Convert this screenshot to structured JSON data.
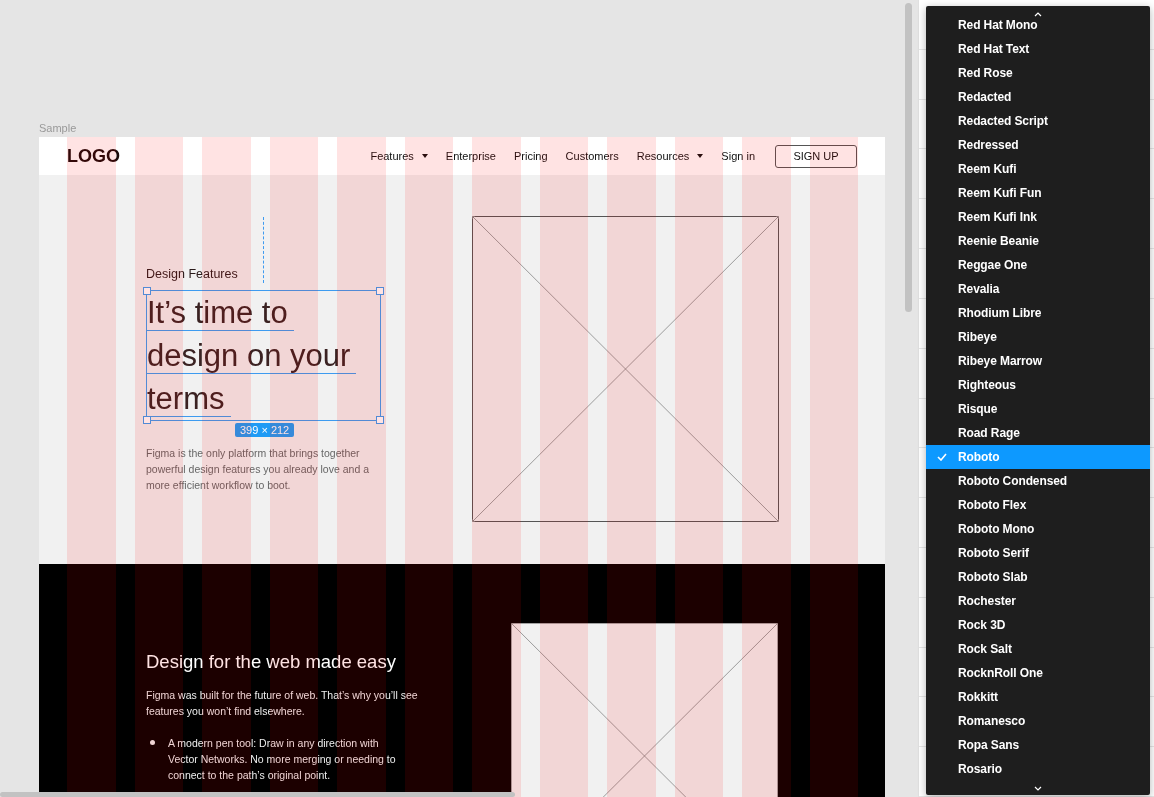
{
  "canvas": {
    "frame_label": "Sample"
  },
  "nav": {
    "logo": "LOGO",
    "links": [
      {
        "label": "Features",
        "dropdown": true
      },
      {
        "label": "Enterprise",
        "dropdown": false
      },
      {
        "label": "Pricing",
        "dropdown": false
      },
      {
        "label": "Customers",
        "dropdown": false
      },
      {
        "label": "Resources",
        "dropdown": true
      },
      {
        "label": "Sign in",
        "dropdown": false
      }
    ],
    "signup_button": "SIGN UP"
  },
  "hero": {
    "eyebrow": "Design Features",
    "heading_lines": [
      "It’s time to",
      "design on your",
      "terms"
    ],
    "selection_size": "399 × 212",
    "body": "Figma is the only platform that brings together powerful design features you already love and a more efficient workflow to boot."
  },
  "dark_section": {
    "heading": "Design for the web made easy",
    "body": "Figma was built for the future of web. That’s why you’ll see features you won’t find elsewhere.",
    "bullets": [
      "A modern pen tool: Draw in any direction with Vector Networks. No more merging or needing to connect to the path’s original point."
    ]
  },
  "font_menu": {
    "items": [
      {
        "label": "Red Hat Mono",
        "selected": false
      },
      {
        "label": "Red Hat Text",
        "selected": false
      },
      {
        "label": "Red Rose",
        "selected": false
      },
      {
        "label": "Redacted",
        "selected": false
      },
      {
        "label": "Redacted Script",
        "selected": false
      },
      {
        "label": "Redressed",
        "selected": false
      },
      {
        "label": "Reem Kufi",
        "selected": false
      },
      {
        "label": "Reem Kufi Fun",
        "selected": false
      },
      {
        "label": "Reem Kufi Ink",
        "selected": false
      },
      {
        "label": "Reenie Beanie",
        "selected": false
      },
      {
        "label": "Reggae One",
        "selected": false
      },
      {
        "label": "Revalia",
        "selected": false
      },
      {
        "label": "Rhodium Libre",
        "selected": false
      },
      {
        "label": "Ribeye",
        "selected": false
      },
      {
        "label": "Ribeye Marrow",
        "selected": false
      },
      {
        "label": "Righteous",
        "selected": false
      },
      {
        "label": "Risque",
        "selected": false
      },
      {
        "label": "Road Rage",
        "selected": false
      },
      {
        "label": "Roboto",
        "selected": true
      },
      {
        "label": "Roboto Condensed",
        "selected": false
      },
      {
        "label": "Roboto Flex",
        "selected": false
      },
      {
        "label": "Roboto Mono",
        "selected": false
      },
      {
        "label": "Roboto Serif",
        "selected": false
      },
      {
        "label": "Roboto Slab",
        "selected": false
      },
      {
        "label": "Rochester",
        "selected": false
      },
      {
        "label": "Rock 3D",
        "selected": false
      },
      {
        "label": "Rock Salt",
        "selected": false
      },
      {
        "label": "RocknRoll One",
        "selected": false
      },
      {
        "label": "Rokkitt",
        "selected": false
      },
      {
        "label": "Romanesco",
        "selected": false
      },
      {
        "label": "Ropa Sans",
        "selected": false
      },
      {
        "label": "Rosario",
        "selected": false
      }
    ]
  }
}
